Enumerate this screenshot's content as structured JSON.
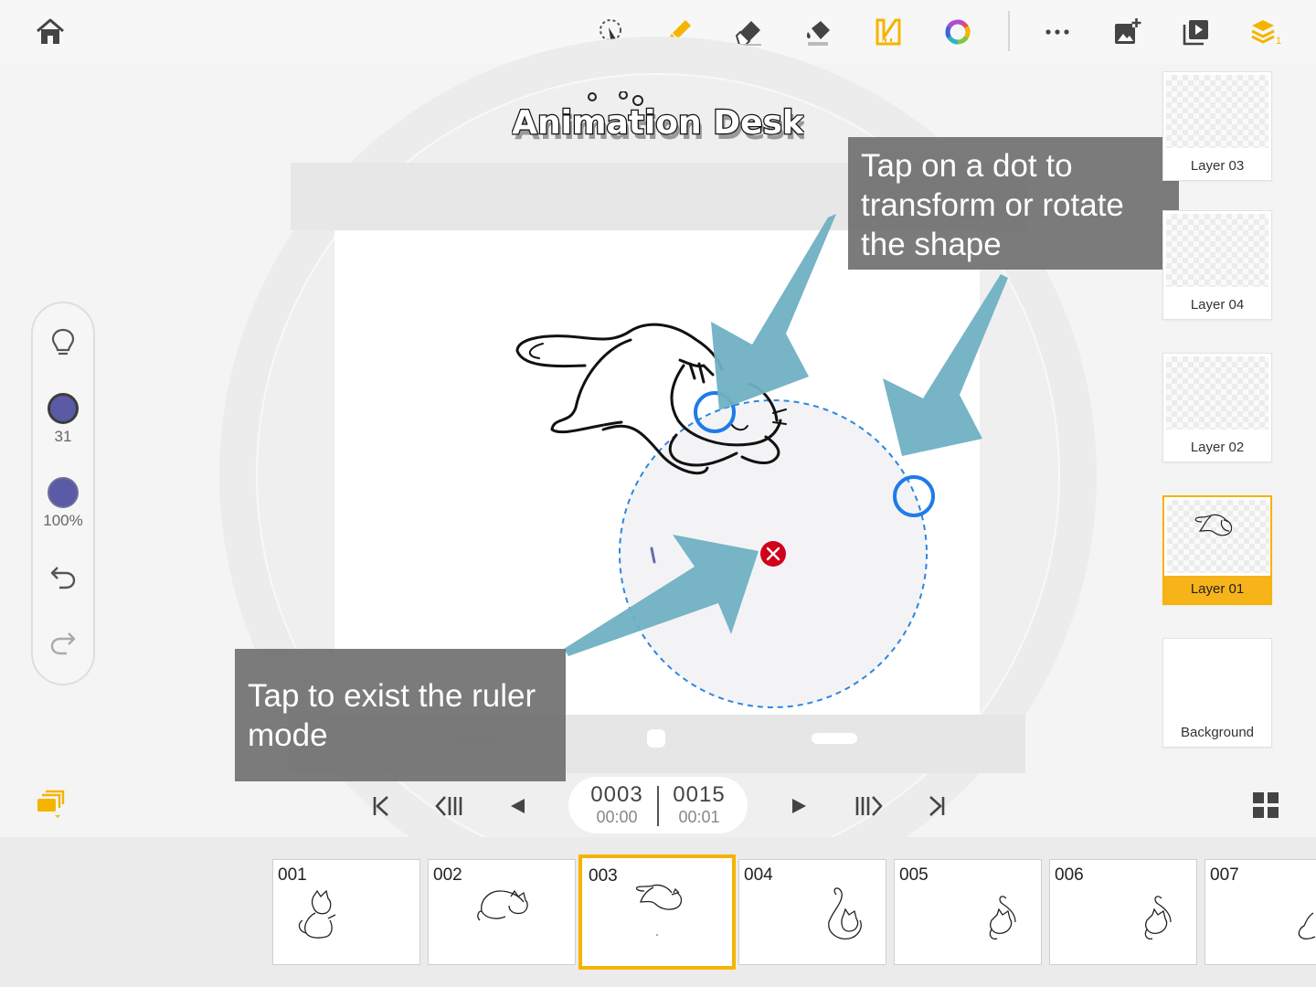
{
  "toolbar": {
    "items": [
      {
        "name": "home",
        "icon": "home-icon"
      },
      {
        "name": "lasso-select",
        "icon": "lasso-icon"
      },
      {
        "name": "brush",
        "icon": "brush-icon"
      },
      {
        "name": "eraser",
        "icon": "eraser-icon"
      },
      {
        "name": "fill",
        "icon": "paint-bucket-icon"
      },
      {
        "name": "ruler",
        "icon": "ruler-icon"
      },
      {
        "name": "color-wheel",
        "icon": "color-wheel-icon"
      },
      {
        "name": "more",
        "icon": "more-icon"
      },
      {
        "name": "add-image",
        "icon": "add-image-icon"
      },
      {
        "name": "play-preview",
        "icon": "play-preview-icon"
      },
      {
        "name": "layers",
        "icon": "layers-icon",
        "badge": "1"
      }
    ],
    "accent_color": "#f5b400"
  },
  "logo": {
    "text": "Animation Desk"
  },
  "palette": {
    "brush_size": "31",
    "opacity": "100%",
    "brush_color": "#5b5aa6"
  },
  "layers": [
    {
      "name": "Layer 03",
      "active": false
    },
    {
      "name": "Layer 04",
      "active": false
    },
    {
      "name": "Layer 02",
      "active": false
    },
    {
      "name": "Layer 01",
      "active": true
    },
    {
      "name": "Background",
      "active": false
    }
  ],
  "callouts": {
    "transform": "Tap on a dot to transform or rotate the shape",
    "exit_ruler": "Tap to exist the ruler mode"
  },
  "playback": {
    "current_frame": "0003",
    "current_time": "00:00",
    "total_frames": "0015",
    "total_time": "00:01"
  },
  "timeline": {
    "frames": [
      "001",
      "002",
      "003",
      "004",
      "005",
      "006",
      "007"
    ],
    "current": "003"
  }
}
